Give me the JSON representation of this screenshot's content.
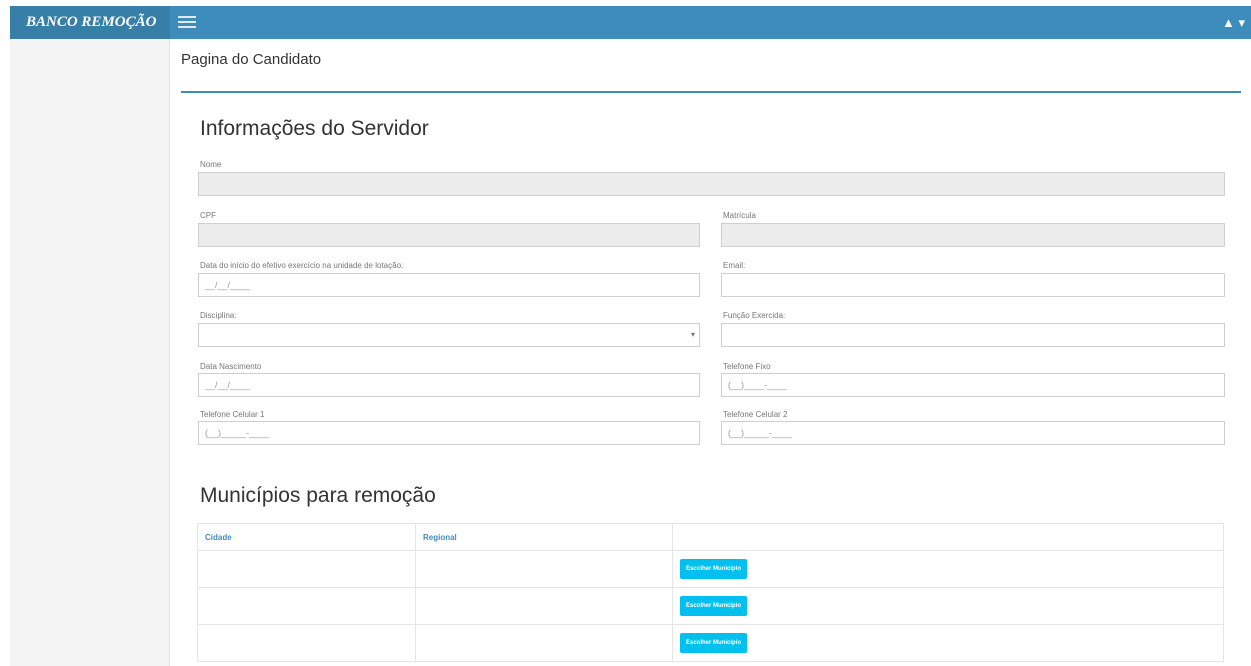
{
  "brand": "BANCO REMOÇÃO",
  "user_menu": "▲ ▾",
  "page_header": "Pagina do Candidato",
  "servidor": {
    "title": "Informações do Servidor",
    "fields": {
      "nome": {
        "label": "Nome",
        "value": ""
      },
      "cpf": {
        "label": "CPF",
        "value": ""
      },
      "matricula": {
        "label": "Matrícula",
        "value": ""
      },
      "data_inicio": {
        "label": "Data do início do efetivo exercício na unidade de lotação:",
        "placeholder": "__/__/____"
      },
      "email": {
        "label": "Email:",
        "value": ""
      },
      "disciplina": {
        "label": "Disciplina:",
        "value": ""
      },
      "funcao": {
        "label": "Função Exercida:",
        "value": ""
      },
      "data_nascimento": {
        "label": "Data Nascimento",
        "placeholder": "__/__/____"
      },
      "telefone_fixo": {
        "label": "Telefone Fixo",
        "placeholder": "(__)____-____"
      },
      "celular1": {
        "label": "Telefone Celular 1",
        "placeholder": "(__)_____-____"
      },
      "celular2": {
        "label": "Telefone Celular 2",
        "placeholder": "(__)_____-____"
      }
    }
  },
  "municipios": {
    "title": "Municípios para remoção",
    "columns": [
      "Cidade",
      "Regional",
      ""
    ],
    "rows": [
      {
        "cidade": "",
        "regional": "",
        "button": "Escolher Município"
      },
      {
        "cidade": "",
        "regional": "",
        "button": "Escolher Município"
      },
      {
        "cidade": "",
        "regional": "",
        "button": "Escolher Município"
      }
    ]
  },
  "colors": {
    "accent": "#3c8dbc",
    "button": "#00c0ef",
    "brand_bg": "#367fa9"
  }
}
